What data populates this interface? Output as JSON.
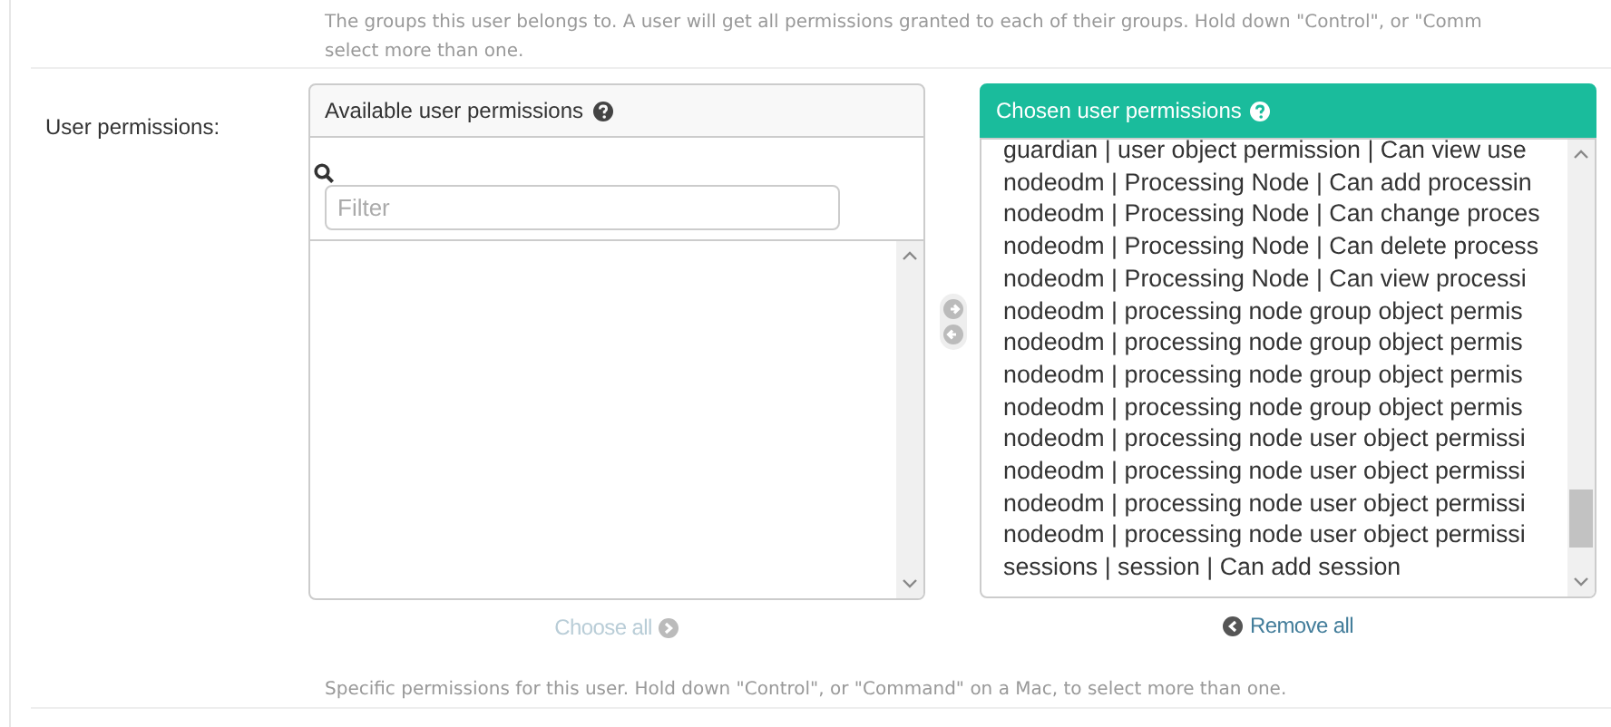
{
  "groups_help": [
    "The groups this user belongs to. A user will get all permissions granted to each of their groups. Hold down \"Control\", or \"Comm",
    "select more than one."
  ],
  "field": {
    "label": "User permissions:",
    "available": {
      "title": "Available user permissions",
      "filter": {
        "placeholder": "Filter"
      },
      "choose_all": {
        "label": "Choose all",
        "disabled": true
      }
    },
    "move_buttons": [
      {
        "kind": "add",
        "disabled": true
      },
      {
        "kind": "remove",
        "disabled": true
      }
    ],
    "chosen": {
      "title": "Chosen user permissions",
      "items": [
        "guardian | user object permission | Can view use",
        "nodeodm | Processing Node | Can add processin",
        "nodeodm | Processing Node | Can change proces",
        "nodeodm | Processing Node | Can delete process",
        "nodeodm | Processing Node | Can view processi",
        "nodeodm | processing node group object permis",
        "nodeodm | processing node group object permis",
        "nodeodm | processing node group object permis",
        "nodeodm | processing node group object permis",
        "nodeodm | processing node user object permissi",
        "nodeodm | processing node user object permissi",
        "nodeodm | processing node user object permissi",
        "nodeodm | processing node user object permissi",
        "sessions | session | Can add session"
      ],
      "remove_all": {
        "label": "Remove all",
        "disabled": false
      }
    },
    "help": "Specific permissions for this user. Hold down \"Control\", or \"Command\" on a Mac, to select more than one."
  }
}
